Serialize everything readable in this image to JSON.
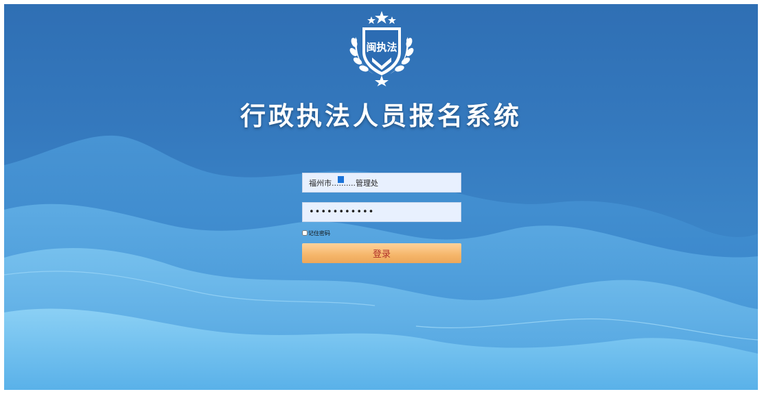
{
  "emblem": {
    "icon": "shield-laurel-emblem-icon",
    "text": "闽执法",
    "colors": {
      "shield": "#ffffff",
      "text": "#1f5fa8"
    }
  },
  "page": {
    "title": "行政执法人员报名系统"
  },
  "login_form": {
    "username_value": "福州市..........管理处",
    "password_value": "•••••••••••",
    "remember_label": "记住密码",
    "submit_label": "登录"
  },
  "colors": {
    "background": "#3478bd",
    "input_bg": "#e8f0fe",
    "button": "#f5b66a",
    "button_text": "#b0302a"
  }
}
